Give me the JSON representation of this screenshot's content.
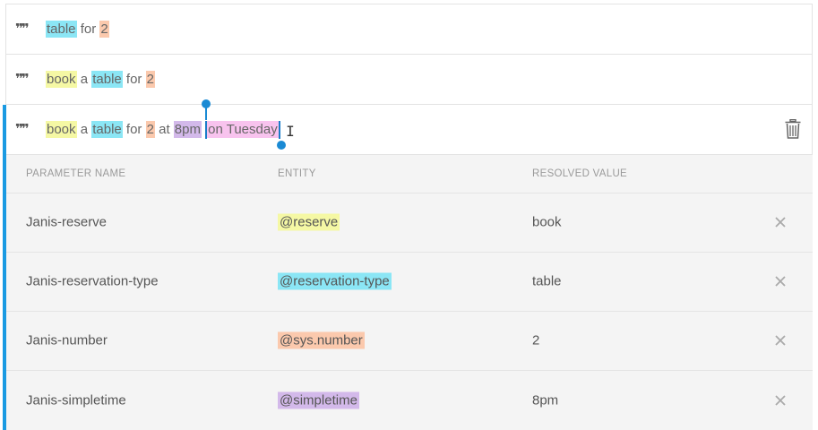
{
  "phrases": [
    {
      "segments": [
        {
          "text": "table",
          "hl": "cyan"
        },
        {
          "text": " for ",
          "hl": ""
        },
        {
          "text": "2",
          "hl": "orange"
        }
      ]
    },
    {
      "segments": [
        {
          "text": "book",
          "hl": "yellow"
        },
        {
          "text": " a ",
          "hl": ""
        },
        {
          "text": "table",
          "hl": "cyan"
        },
        {
          "text": " for ",
          "hl": ""
        },
        {
          "text": "2",
          "hl": "orange"
        }
      ]
    },
    {
      "segments": [
        {
          "text": "book",
          "hl": "yellow"
        },
        {
          "text": " a ",
          "hl": ""
        },
        {
          "text": "table",
          "hl": "cyan"
        },
        {
          "text": " for ",
          "hl": ""
        },
        {
          "text": "2",
          "hl": "orange"
        },
        {
          "text": " at ",
          "hl": ""
        },
        {
          "text": "8pm",
          "hl": "purple"
        },
        {
          "text": " ",
          "hl": ""
        }
      ],
      "selected_text": "on Tuesday"
    }
  ],
  "table": {
    "headers": {
      "name": "PARAMETER NAME",
      "entity": "ENTITY",
      "value": "RESOLVED VALUE"
    },
    "rows": [
      {
        "name": "Janis-reserve",
        "entity": "@reserve",
        "color": "yellow",
        "value": "book"
      },
      {
        "name": "Janis-reservation-type",
        "entity": "@reservation-type",
        "color": "cyan",
        "value": "table"
      },
      {
        "name": "Janis-number",
        "entity": "@sys.number",
        "color": "orange",
        "value": "2"
      },
      {
        "name": "Janis-simpletime",
        "entity": "@simpletime",
        "color": "purple",
        "value": "8pm"
      }
    ]
  },
  "icons": {
    "quote": "quote-icon",
    "delete": "trash-icon",
    "remove": "close-icon"
  },
  "colors": {
    "accent": "#1a9ae2",
    "yellow": "#f5f8a4",
    "cyan": "#8be6f5",
    "orange": "#fbc9ad",
    "purple": "#d3b9ea",
    "pink": "#f8c3ee"
  }
}
